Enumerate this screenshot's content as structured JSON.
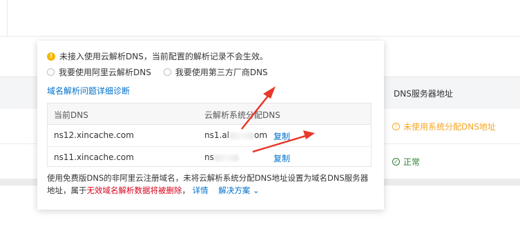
{
  "background": {
    "column_header": "DNS服务器地址",
    "row1_status": "未使用系统分配DNS地址",
    "row2_status": "正常"
  },
  "popover": {
    "warning": "未接入使用云解析DNS，当前配置的解析记录不会生效。",
    "radio_options": [
      "我要使用阿里云解析DNS",
      "我要使用第三方厂商DNS"
    ],
    "diagnose_link": "域名解析问题详细诊断",
    "table": {
      "headers": [
        "当前DNS",
        "云解析系统分配DNS"
      ],
      "rows": [
        {
          "current": "ns12.xincache.com",
          "assigned_prefix": "ns1.al",
          "assigned_suffix": "om",
          "action": "复制"
        },
        {
          "current": "ns11.xincache.com",
          "assigned_prefix": "ns",
          "assigned_suffix": "",
          "action": "复制"
        }
      ]
    },
    "note": {
      "part1": "使用免费版DNS的非阿里云注册域名，未将云解析系统分配DNS地址设置为域名DNS服务器地址，属于",
      "red": "无效域名解析数据将被删除",
      "part2": "，",
      "details": "详情",
      "solution": "解决方案"
    }
  },
  "colors": {
    "link": "#0070cc",
    "warning": "#f5a623",
    "ok": "#2e7d32",
    "danger": "#d9001b",
    "annotation_arrow": "#e8392b"
  }
}
